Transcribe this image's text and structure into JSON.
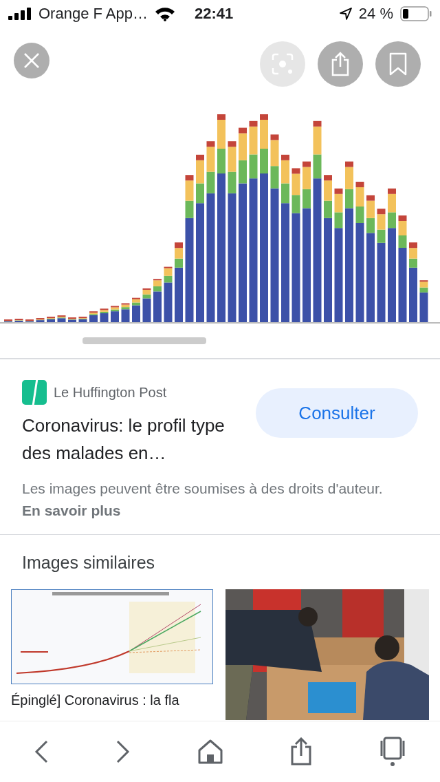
{
  "status_bar": {
    "carrier": "Orange F App…",
    "time": "22:41",
    "battery": "24 %"
  },
  "source": {
    "name": "Le Huffington Post",
    "title": "Coronavirus: le profil type des malades en…",
    "button": "Consulter"
  },
  "copyright": {
    "text": "Les images peuvent être soumises à des droits d'auteur.",
    "link": "En savoir plus"
  },
  "similar": {
    "heading": "Images similaires",
    "caption": "Épinglé] Coronavirus : la fla"
  }
}
